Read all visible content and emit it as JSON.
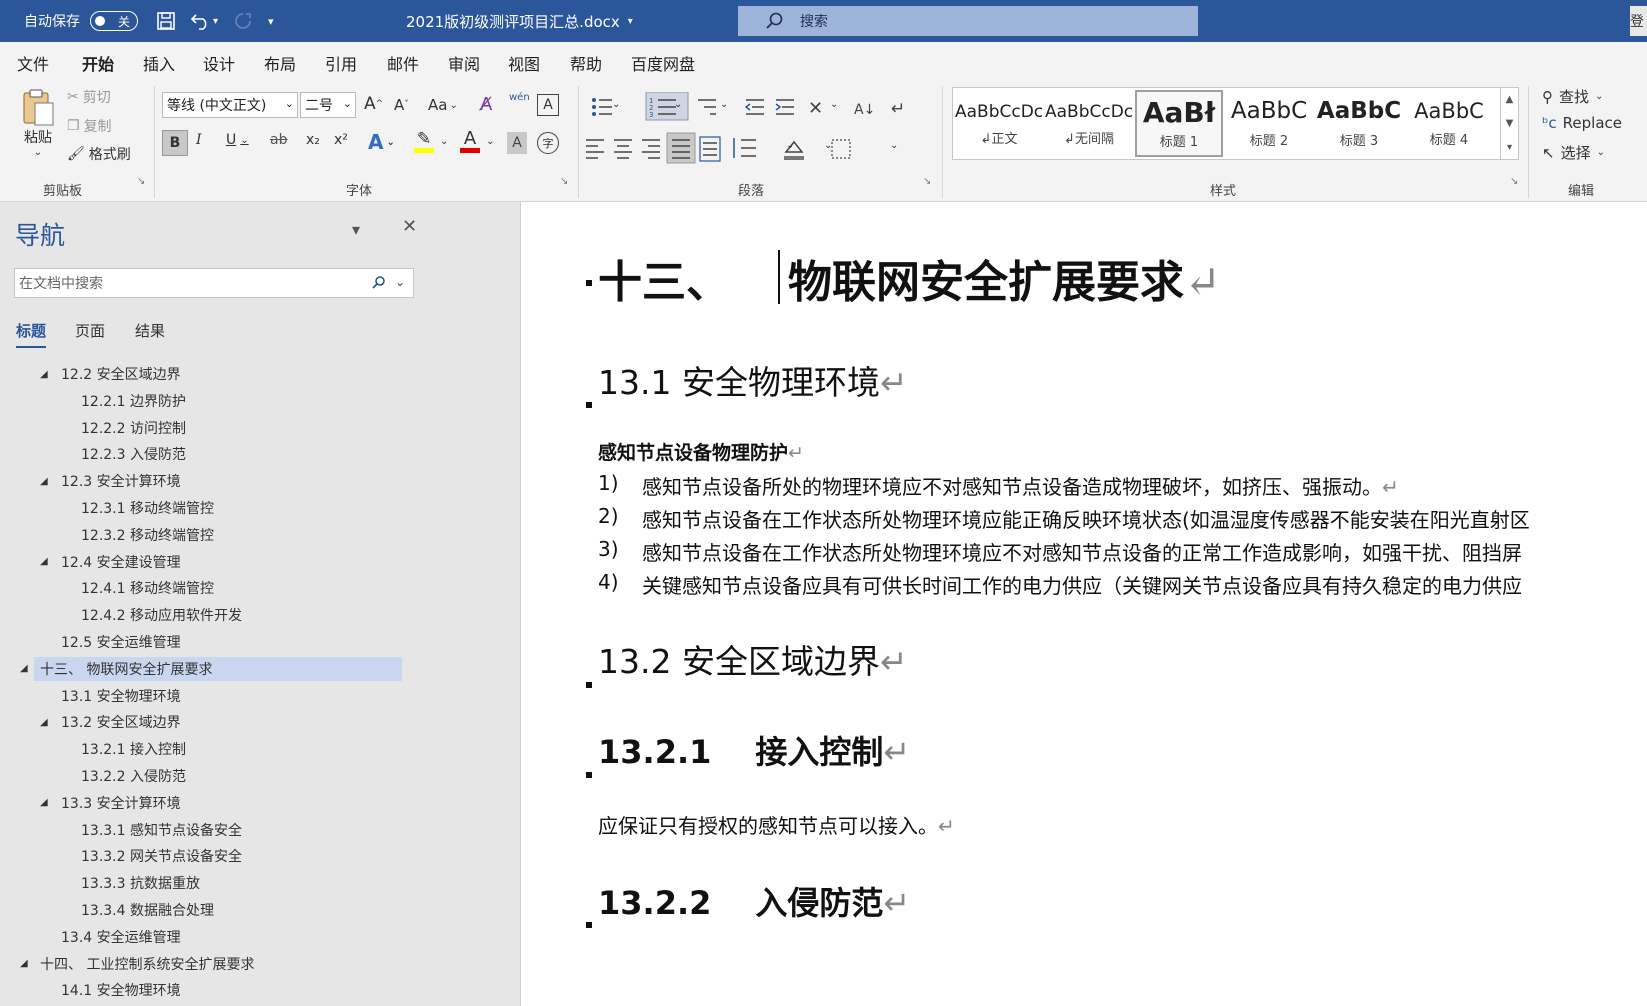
{
  "titlebar": {
    "autosave_label": "自动保存",
    "autosave_state": "关",
    "doc_title": "2021版初级测评项目汇总.docx",
    "search_placeholder": "搜索",
    "right_edge_text": "登"
  },
  "tabs": [
    "文件",
    "开始",
    "插入",
    "设计",
    "布局",
    "引用",
    "邮件",
    "审阅",
    "视图",
    "帮助",
    "百度网盘"
  ],
  "active_tab": "开始",
  "ribbon": {
    "clipboard": {
      "label": "剪贴板",
      "paste": "粘贴",
      "cut": "剪切",
      "copy": "复制",
      "format_painter": "格式刷"
    },
    "font": {
      "label": "字体",
      "font_name": "等线 (中文正文)",
      "font_size": "二号",
      "aa": "Aa",
      "pinyin": "wén",
      "bold": "B",
      "italic": "I",
      "underline": "U",
      "strike": "ab",
      "sub": "x₂",
      "sup": "x²",
      "text_effect": "A",
      "highlight": "✎",
      "font_color": "A",
      "char_shade": "A",
      "enclose": "字"
    },
    "paragraph": {
      "label": "段落"
    },
    "styles": {
      "label": "样式",
      "items": [
        {
          "sample": "AaBbCcDc",
          "name": "↲正文"
        },
        {
          "sample": "AaBbCcDc",
          "name": "↲无间隔"
        },
        {
          "sample": "AaBł",
          "name": "标题 1"
        },
        {
          "sample": "AaBbC",
          "name": "标题 2"
        },
        {
          "sample": "AaBbC",
          "name": "标题 3"
        },
        {
          "sample": "AaBbC",
          "name": "标题 4"
        }
      ]
    },
    "editing": {
      "label": "编辑",
      "find": "查找",
      "replace": "Replace",
      "select": "选择"
    }
  },
  "nav": {
    "title": "导航",
    "search_placeholder": "在文档中搜索",
    "tabs": [
      "标题",
      "页面",
      "结果"
    ],
    "items": [
      {
        "level": 2,
        "text": "12.2 安全区域边界",
        "expanded": true
      },
      {
        "level": 3,
        "text": "12.2.1 边界防护"
      },
      {
        "level": 3,
        "text": "12.2.2 访问控制"
      },
      {
        "level": 3,
        "text": "12.2.3 入侵防范"
      },
      {
        "level": 2,
        "text": "12.3 安全计算环境",
        "expanded": true
      },
      {
        "level": 3,
        "text": "12.3.1 移动终端管控"
      },
      {
        "level": 3,
        "text": "12.3.2 移动终端管控"
      },
      {
        "level": 2,
        "text": "12.4 安全建设管理",
        "expanded": true
      },
      {
        "level": 3,
        "text": "12.4.1 移动终端管控"
      },
      {
        "level": 3,
        "text": "12.4.2 移动应用软件开发"
      },
      {
        "level": 2,
        "text": "12.5 安全运维管理"
      },
      {
        "level": 1,
        "text": "十三、 物联网安全扩展要求",
        "expanded": true,
        "selected": true
      },
      {
        "level": 2,
        "text": "13.1 安全物理环境"
      },
      {
        "level": 2,
        "text": "13.2 安全区域边界",
        "expanded": true
      },
      {
        "level": 3,
        "text": "13.2.1 接入控制"
      },
      {
        "level": 3,
        "text": "13.2.2 入侵防范"
      },
      {
        "level": 2,
        "text": "13.3 安全计算环境",
        "expanded": true
      },
      {
        "level": 3,
        "text": "13.3.1 感知节点设备安全"
      },
      {
        "level": 3,
        "text": "13.3.2 网关节点设备安全"
      },
      {
        "level": 3,
        "text": "13.3.3 抗数据重放"
      },
      {
        "level": 3,
        "text": "13.3.4 数据融合处理"
      },
      {
        "level": 2,
        "text": "13.4 安全运维管理"
      },
      {
        "level": 1,
        "text": "十四、 工业控制系统安全扩展要求",
        "expanded": true
      },
      {
        "level": 2,
        "text": "14.1 安全物理环境"
      }
    ]
  },
  "document": {
    "h1_num": "十三、",
    "h1_text": "物联网安全扩展要求",
    "h2_1": "13.1  安全物理环境",
    "bold_para": "感知节点设备物理防护",
    "list": [
      {
        "n": "1)",
        "t": "感知节点设备所处的物理环境应不对感知节点设备造成物理破坏，如挤压、强振动。"
      },
      {
        "n": "2)",
        "t": "感知节点设备在工作状态所处物理环境应能正确反映环境状态(如温湿度传感器不能安装在阳光直射区"
      },
      {
        "n": "3)",
        "t": "感知节点设备在工作状态所处物理环境应不对感知节点设备的正常工作造成影响，如强干扰、阻挡屏"
      },
      {
        "n": "4)",
        "t": "关键感知节点设备应具有可供长时间工作的电力供应（关键网关节点设备应具有持久稳定的电力供应"
      }
    ],
    "h2_2": "13.2  安全区域边界",
    "h3_1_num": "13.2.1",
    "h3_1_text": "接入控制",
    "body_1": "应保证只有授权的感知节点可以接入。",
    "h3_2_num": "13.2.2",
    "h3_2_text": "入侵防范",
    "para_mark": "↵"
  },
  "colors": {
    "accent": "#2b579a",
    "ribbon_bg": "#f3f3f3",
    "nav_bg": "#e6e6e6",
    "nav_selected": "#c9d6ef"
  }
}
